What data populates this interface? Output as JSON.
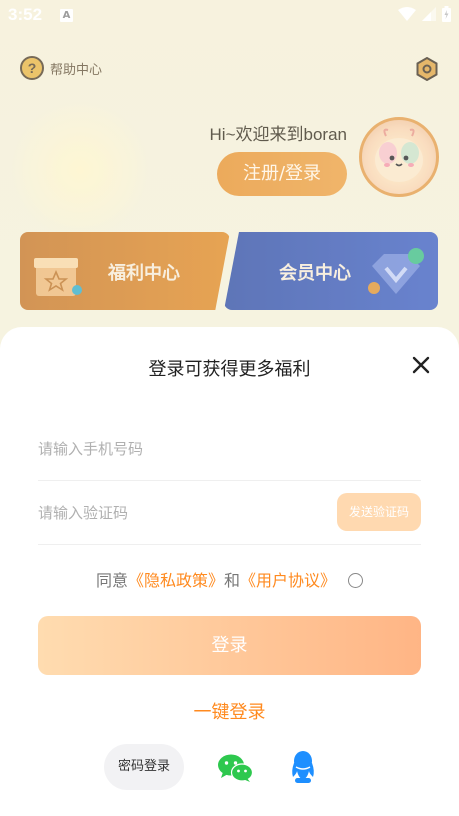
{
  "status_bar": {
    "time": "3:52",
    "notification_icon": "A"
  },
  "background": {
    "help_label": "帮助中心",
    "greeting": "Hi~欢迎来到boran",
    "register_button": "注册/登录",
    "welfare_card": "福利中心",
    "vip_card": "会员中心"
  },
  "sheet": {
    "title": "登录可获得更多福利",
    "phone_placeholder": "请输入手机号码",
    "code_placeholder": "请输入验证码",
    "send_code_button": "发送验证码",
    "agree_prefix": "同意",
    "privacy_link": "《隐私政策》",
    "agree_and": "和",
    "user_agreement_link": "《用户协议》",
    "login_button": "登录",
    "one_key_login": "一键登录",
    "password_login": "密码登录"
  },
  "icons": {
    "help": "help-icon",
    "settings": "settings-icon",
    "close": "close-icon",
    "wechat": "wechat-icon",
    "qq": "qq-icon"
  },
  "colors": {
    "accent": "#ff8a1f",
    "login_gradient_start": "#ffdcb0",
    "login_gradient_end": "#ffb585",
    "welfare_card": "#d98830",
    "vip_card": "#4262b8"
  }
}
